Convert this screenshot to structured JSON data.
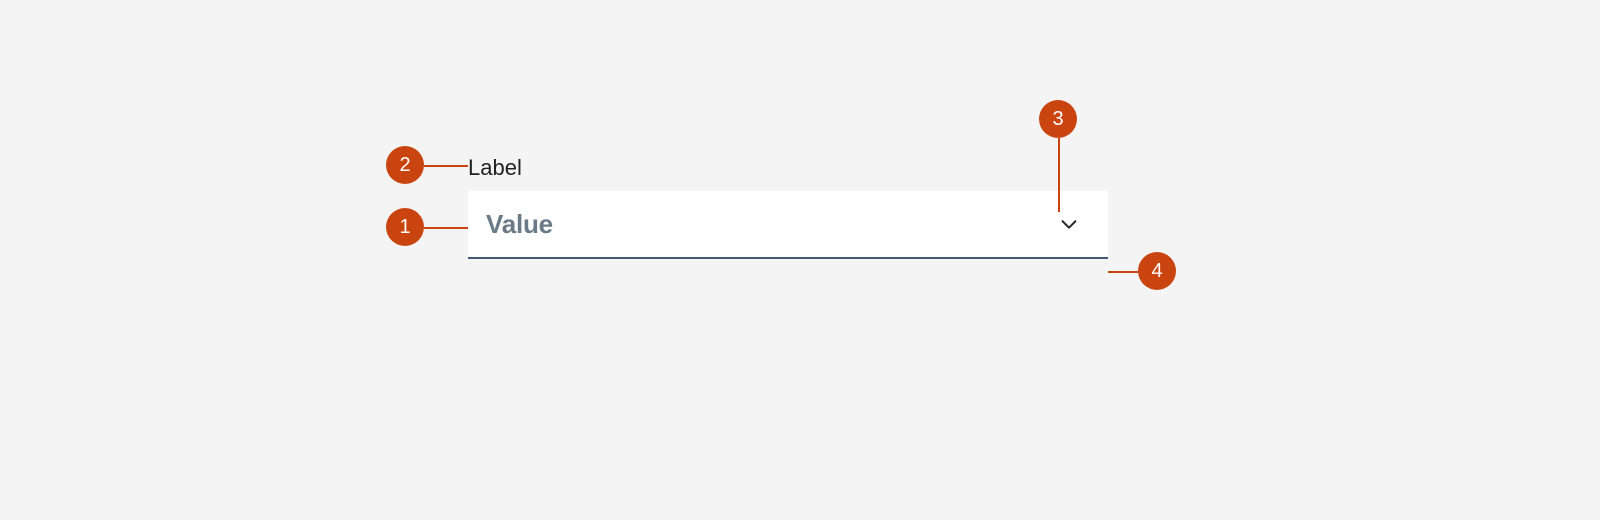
{
  "colors": {
    "accent": "#c9440f",
    "field_bg": "#ffffff",
    "page_bg": "#f4f4f4",
    "value_text": "#6a7a86",
    "underline": "#455a70"
  },
  "select": {
    "label": "Label",
    "value": "Value",
    "chevron_icon": "chevron-down"
  },
  "annotations": [
    {
      "id": "1",
      "target": "value-text"
    },
    {
      "id": "2",
      "target": "label-text"
    },
    {
      "id": "3",
      "target": "chevron-icon"
    },
    {
      "id": "4",
      "target": "underline"
    }
  ]
}
